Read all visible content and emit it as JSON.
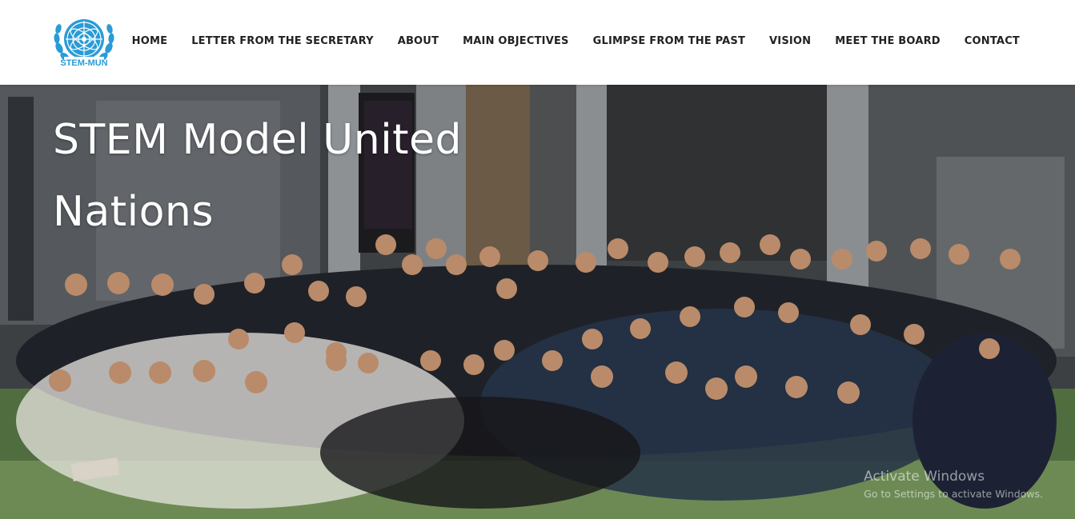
{
  "logo": {
    "text": "STEM-MUN"
  },
  "nav": {
    "items": [
      {
        "label": "HOME"
      },
      {
        "label": "LETTER FROM THE SECRETARY"
      },
      {
        "label": "ABOUT"
      },
      {
        "label": "MAIN OBJECTIVES"
      },
      {
        "label": "GLIMPSE FROM THE PAST"
      },
      {
        "label": "VISION"
      },
      {
        "label": "MEET THE BOARD"
      },
      {
        "label": "CONTACT"
      }
    ]
  },
  "hero": {
    "title": "STEM Model United Nations",
    "photo_subject": "group-photo-of-delegates"
  },
  "watermark": {
    "title": "Activate Windows",
    "subtitle": "Go to Settings to activate Windows."
  },
  "colors": {
    "logo_blue": "#2a9bd6",
    "nav_text": "#222222",
    "hero_text": "#ffffff"
  }
}
